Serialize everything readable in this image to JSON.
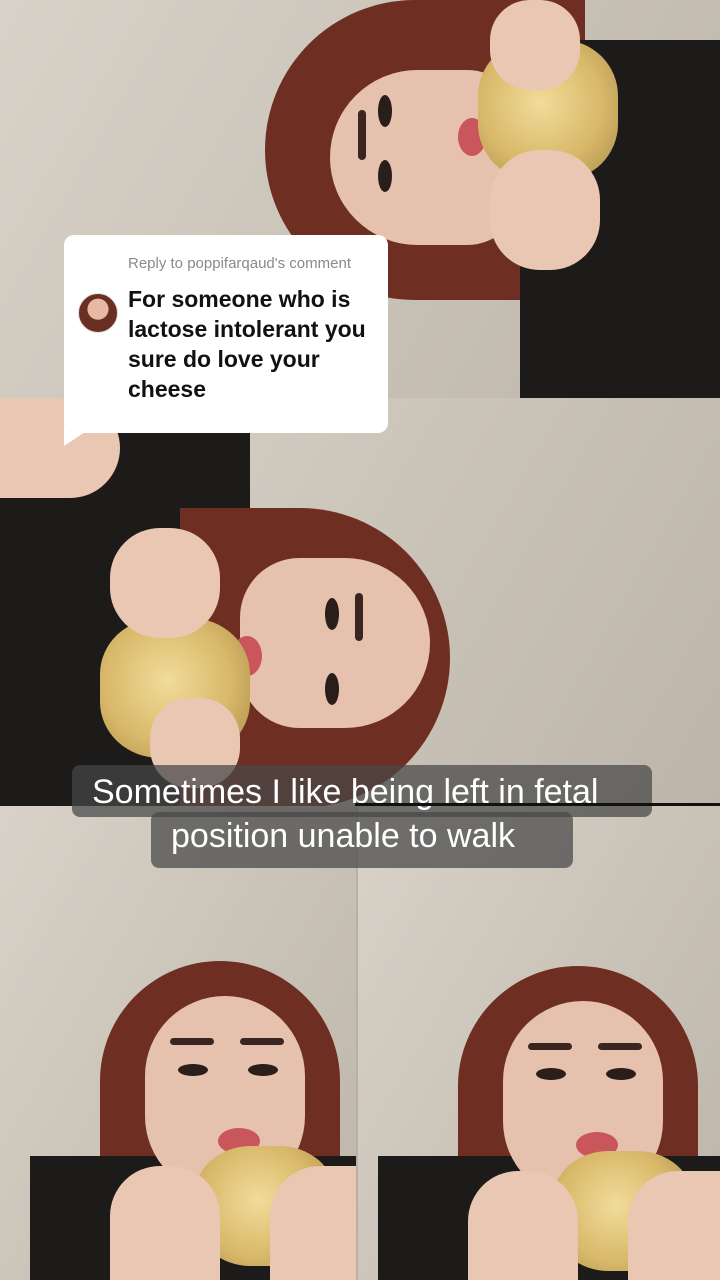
{
  "comment_reply": {
    "reply_to": "Reply to poppifarqaud's comment",
    "comment": "For someone who is lactose intolerant you sure do love your cheese"
  },
  "caption": {
    "line1": "Sometimes I like being left in fetal",
    "line2": "position unable to walk"
  },
  "colors": {
    "caption_bg": "#464646",
    "bubble_bg": "#ffffff",
    "hair": "#6e2f22"
  }
}
